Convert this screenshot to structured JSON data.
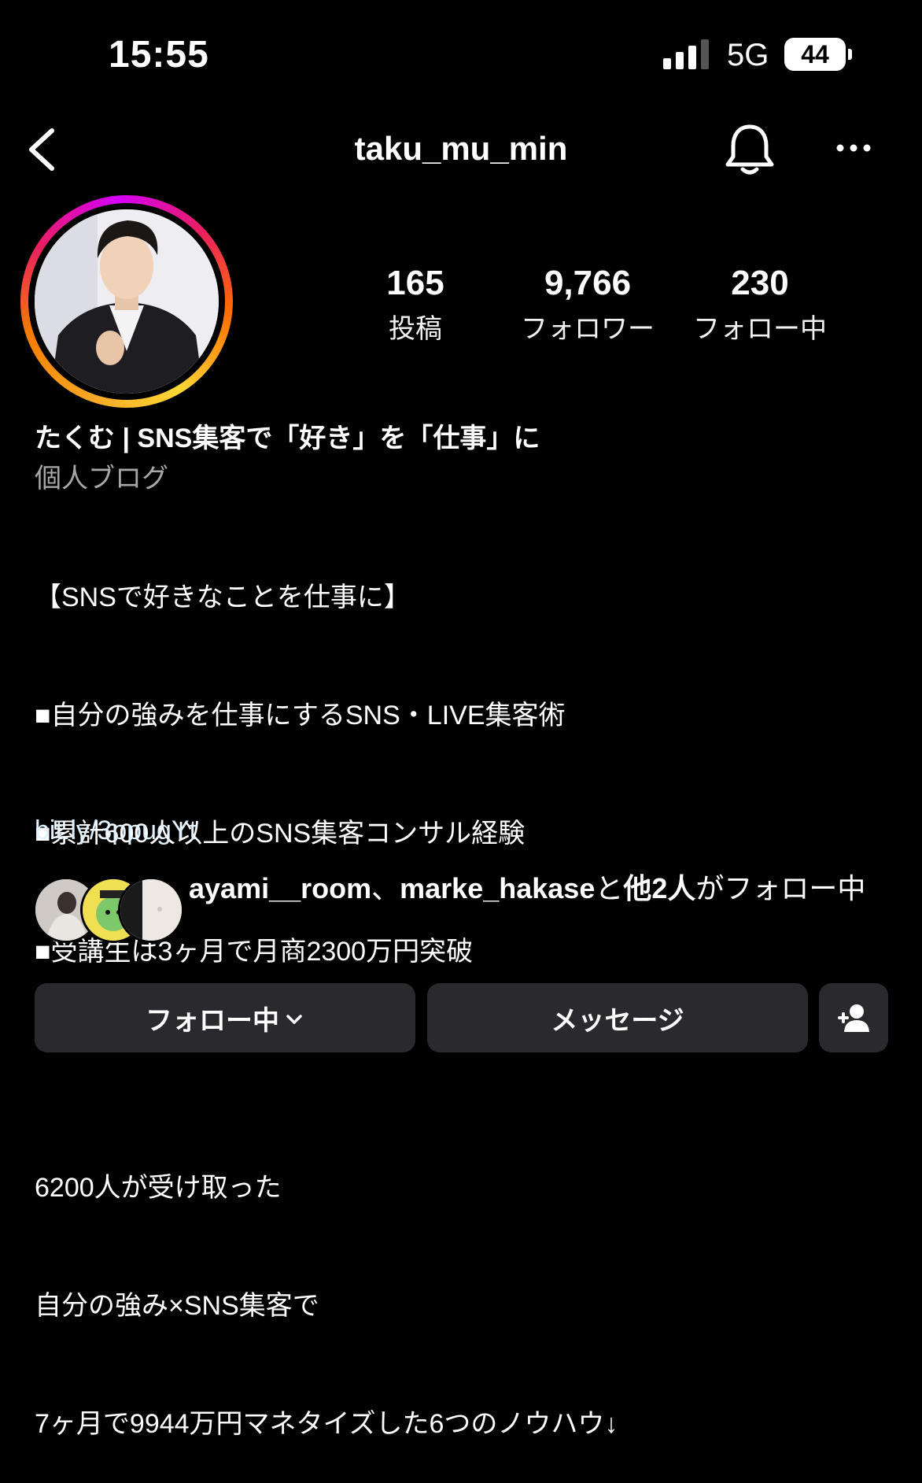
{
  "status_bar": {
    "time": "15:55",
    "network": "5G",
    "battery": "44"
  },
  "header": {
    "username": "taku_mu_min",
    "back_icon": "chevron-left-icon",
    "bell_icon": "bell-icon",
    "more_icon": "more-horizontal-icon"
  },
  "stats": [
    {
      "value": "165",
      "label": "投稿"
    },
    {
      "value": "9,766",
      "label": "フォロワー"
    },
    {
      "value": "230",
      "label": "フォロー中"
    }
  ],
  "bio": {
    "name": "たくむ | SNS集客で「好き」を「仕事」に",
    "category": "個人ブログ",
    "lines": [
      "【SNSで好きなことを仕事に】",
      "■自分の強みを仕事にするSNS・LIVE集客術",
      "■累計600人以上のSNS集客コンサル経験",
      "■受講生は3ヶ月で月商2300万円突破",
      "",
      "6200人が受け取った",
      "自分の強み×SNS集客で",
      "7ヶ月で9944万円マネタイズした6つのノウハウ↓"
    ],
    "link": "bit.ly/3ppugYt"
  },
  "followed_by": {
    "user1": "ayami__room",
    "sep": "、",
    "user2": "marke_hakase",
    "and": "と",
    "others": "他2人",
    "suffix": "がフォロー中"
  },
  "buttons": {
    "following": "フォロー中",
    "message": "メッセージ",
    "add_user_icon": "person-add-icon"
  }
}
